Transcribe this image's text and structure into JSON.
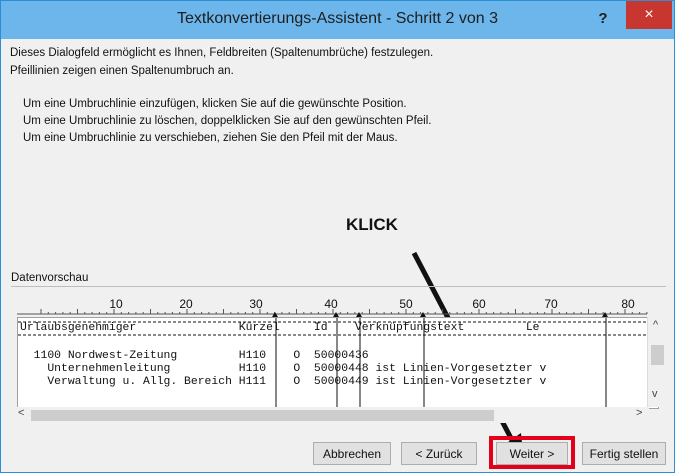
{
  "window": {
    "title": "Textkonvertierungs-Assistent - Schritt 2 von 3",
    "help_label": "?",
    "close_label": "×"
  },
  "description": {
    "line1": "Dieses Dialogfeld ermöglicht es Ihnen, Feldbreiten (Spaltenumbrüche) festzulegen.",
    "line2": "Pfeillinien zeigen einen Spaltenumbruch an."
  },
  "instructions": [
    "Um eine Umbruchlinie einzufügen, klicken Sie auf die gewünschte Position.",
    "Um eine Umbruchlinie zu löschen, doppelklicken Sie auf den gewünschten Pfeil.",
    "Um eine Umbruchlinie zu verschieben, ziehen Sie den Pfeil mit der Maus."
  ],
  "annotation": {
    "text": "KLICK",
    "color": "#e2001a"
  },
  "preview": {
    "label": "Datenvorschau",
    "ruler_ticks": [
      "10",
      "20",
      "30",
      "40",
      "50",
      "60",
      "70",
      "80"
    ],
    "rows": [
      "Urlaubsgenehmiger               Kürzel     Id    Verknüpfungstext         Le",
      "",
      "  1100 Nordwest-Zeitung         H110    O  50000436",
      "    Unternehmenleitung          H110    O  50000448 ist Linien-Vorgesetzter v",
      "    Verwaltung u. Allg. Bereich H111    O  50000449 ist Linien-Vorgesetzter v"
    ]
  },
  "buttons": {
    "cancel": "Abbrechen",
    "back": "< Zurück",
    "next": "Weiter >",
    "finish": "Fertig stellen"
  }
}
